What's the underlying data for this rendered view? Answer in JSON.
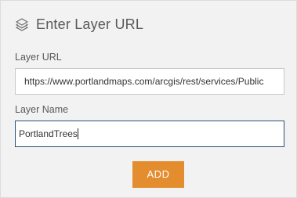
{
  "panel": {
    "title": "Enter Layer URL",
    "title_icon": "layers-icon"
  },
  "form": {
    "url_label": "Layer URL",
    "url_value": "https://www.portlandmaps.com/arcgis/rest/services/Public",
    "name_label": "Layer Name",
    "name_value": "PortlandTrees"
  },
  "actions": {
    "add_label": "ADD"
  },
  "colors": {
    "accent": "#e38d2f",
    "focus_border": "#2b4f7a",
    "background": "#f2f2f2"
  }
}
